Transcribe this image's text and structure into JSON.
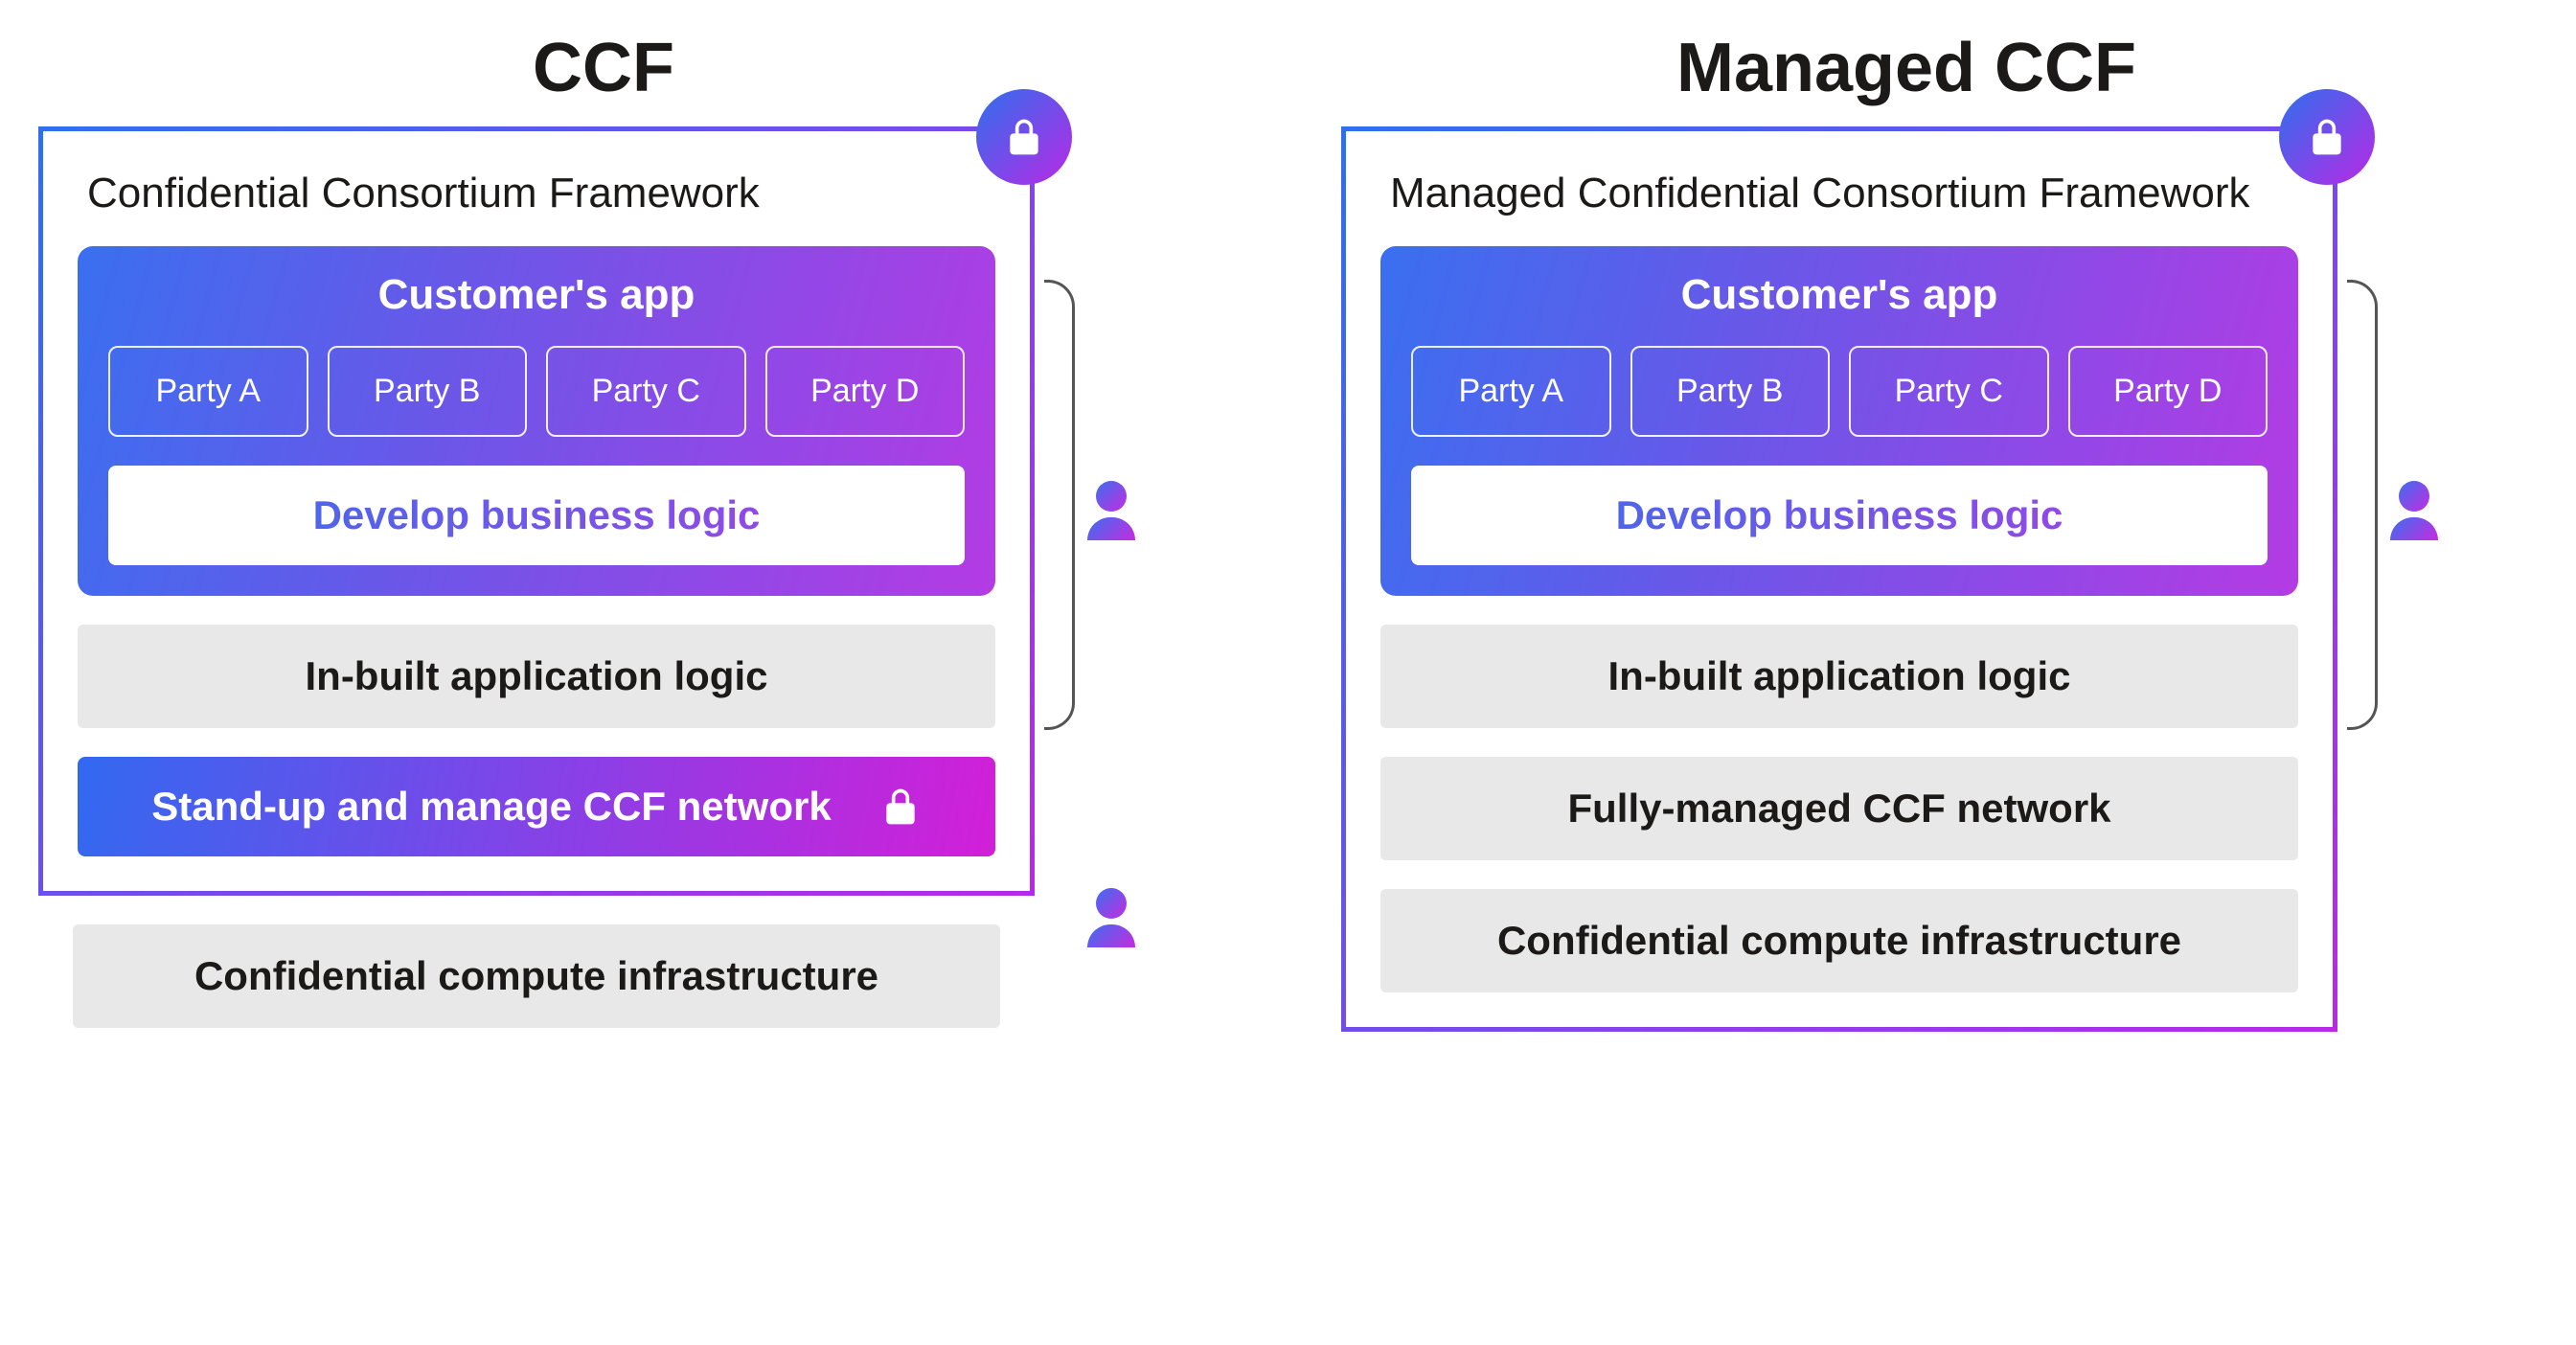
{
  "left": {
    "title": "CCF",
    "framework_title": "Confidential Consortium Framework",
    "app_title": "Customer's app",
    "parties": [
      "Party A",
      "Party B",
      "Party C",
      "Party D"
    ],
    "develop_label": "Develop business logic",
    "layer_inbuilt": "In-built application logic",
    "standup_label": "Stand-up and manage CCF network",
    "layer_infra": "Confidential compute infrastructure"
  },
  "right": {
    "title": "Managed CCF",
    "framework_title": "Managed Confidential Consortium Framework",
    "app_title": "Customer's app",
    "parties": [
      "Party A",
      "Party B",
      "Party C",
      "Party D"
    ],
    "develop_label": "Develop business logic",
    "layer_inbuilt": "In-built application logic",
    "layer_network": "Fully-managed CCF network",
    "layer_infra": "Confidential compute infrastructure"
  }
}
